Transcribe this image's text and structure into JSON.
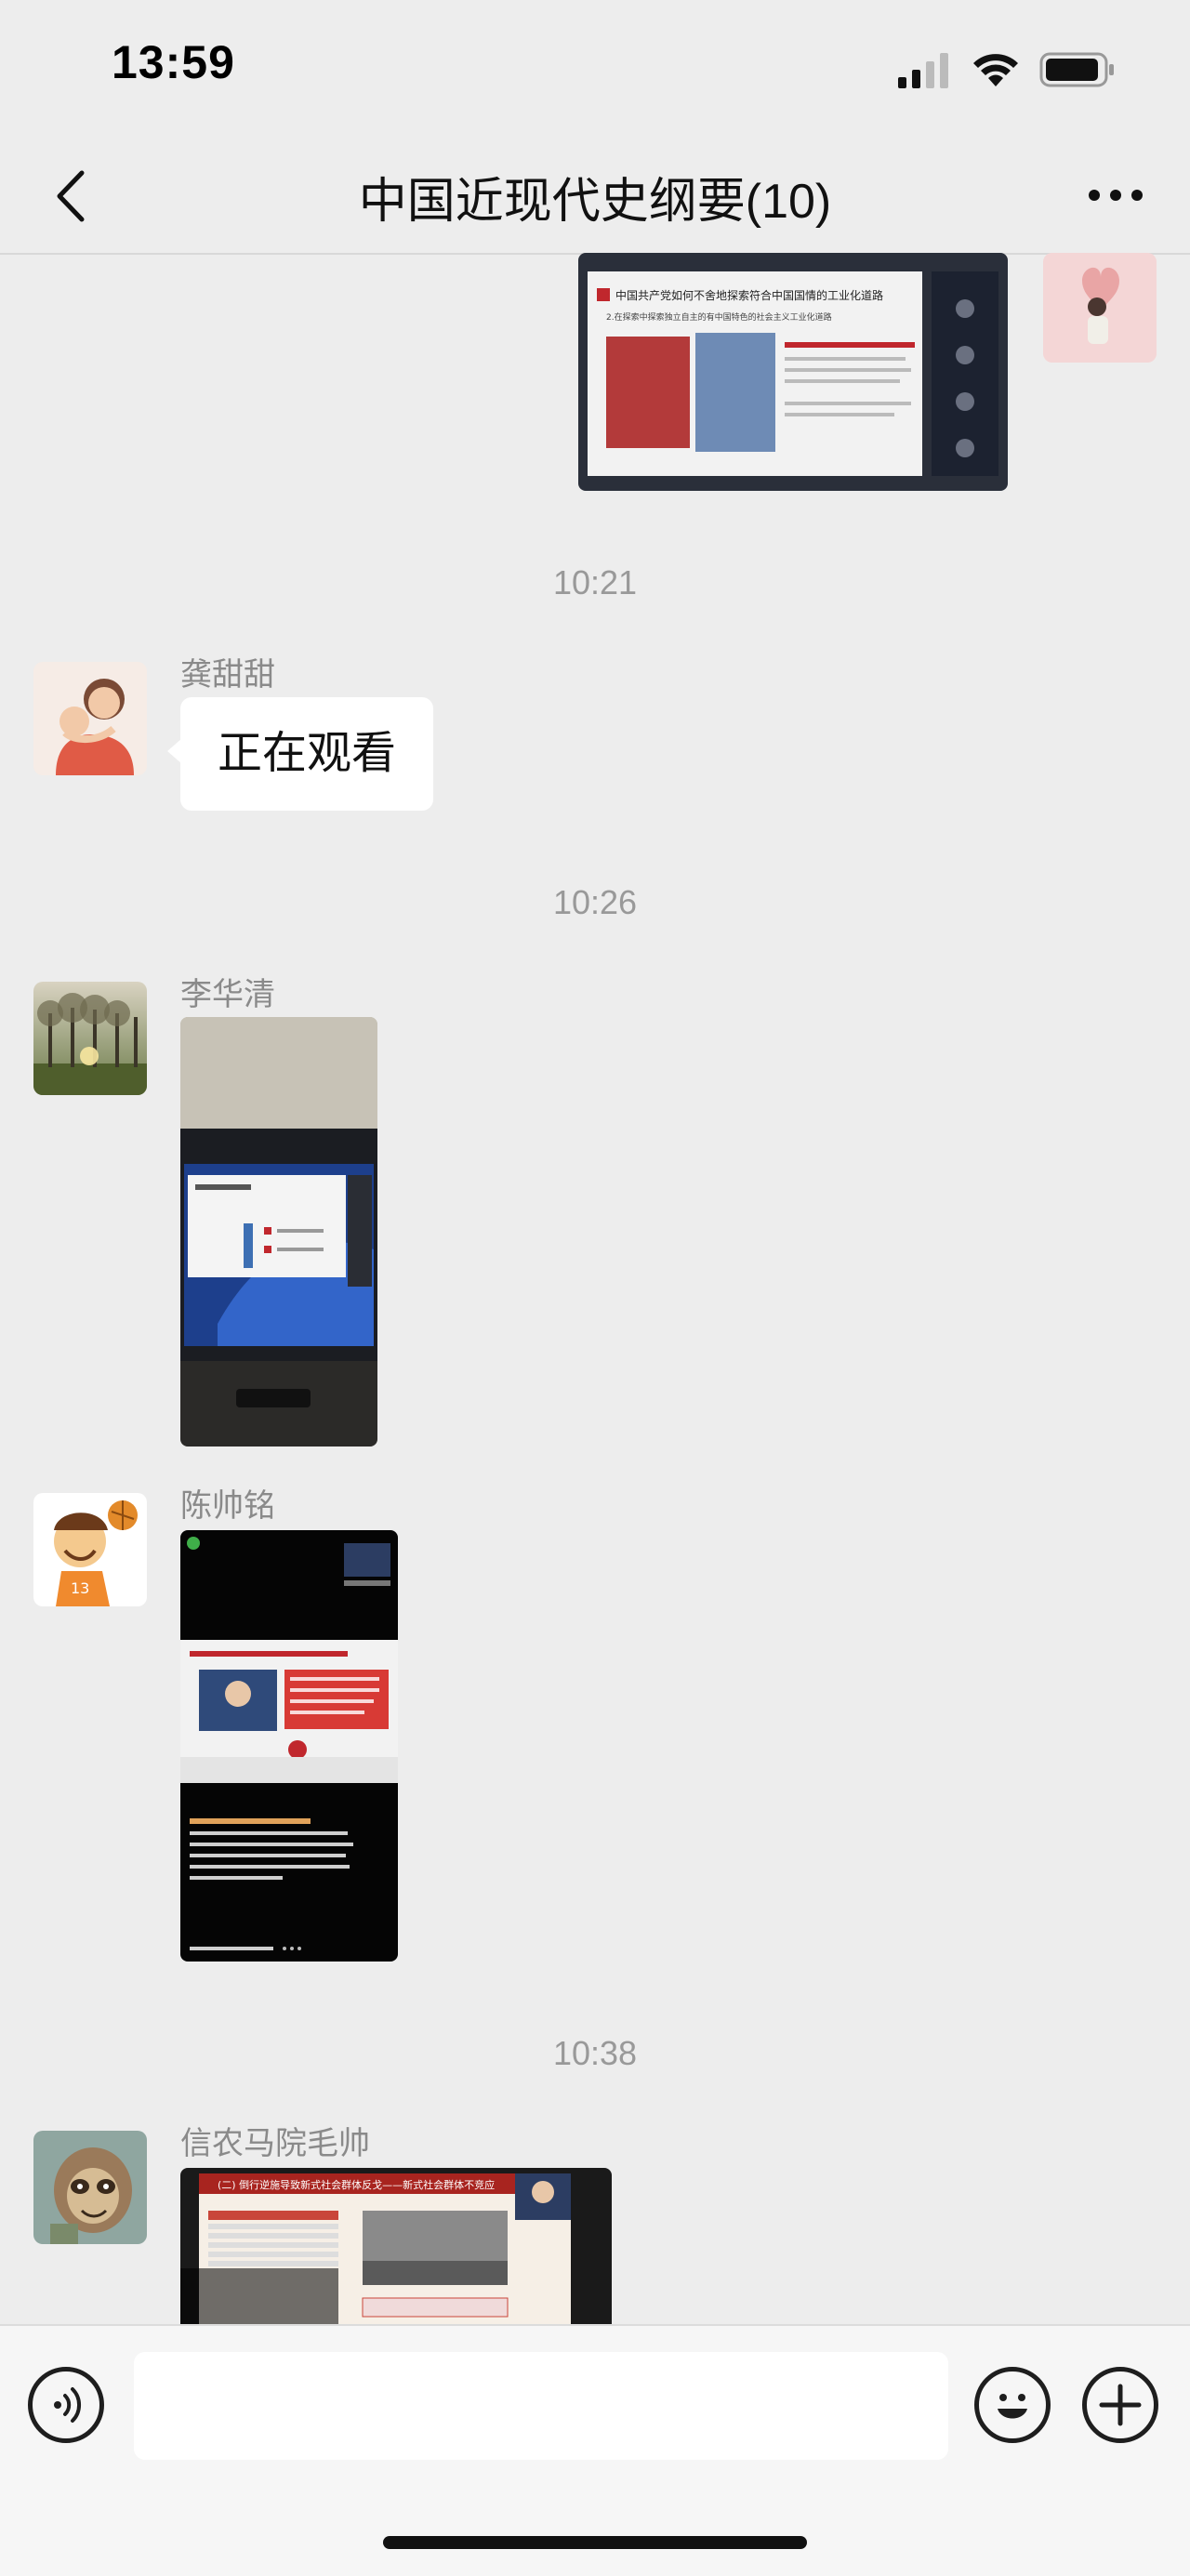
{
  "status_bar": {
    "time": "13:59"
  },
  "nav": {
    "title": "中国近现代史纲要(10)"
  },
  "messages": [
    {
      "type": "time",
      "text": "10:21"
    },
    {
      "type": "text",
      "sender": "龚甜甜",
      "text": "正在观看"
    },
    {
      "type": "time",
      "text": "10:26"
    },
    {
      "type": "image",
      "sender": "李华清"
    },
    {
      "type": "image",
      "sender": "陈帅铭"
    },
    {
      "type": "time",
      "text": "10:38"
    },
    {
      "type": "image",
      "sender": "信农马院毛帅"
    }
  ],
  "slides": {
    "top_title": "中国共产党如何不舍地探索符合中国国情的工业化道路",
    "top_subtitle": "2.在探索中探索独立自主的有中国特色的社会主义工业化道路",
    "last_title": "(二) 倒行逆施导致新式社会群体反戈——新式社会群体不竞应"
  },
  "input": {
    "placeholder": ""
  },
  "colors": {
    "background": "#ededed",
    "bubble": "#ffffff",
    "time_label": "#999999"
  }
}
